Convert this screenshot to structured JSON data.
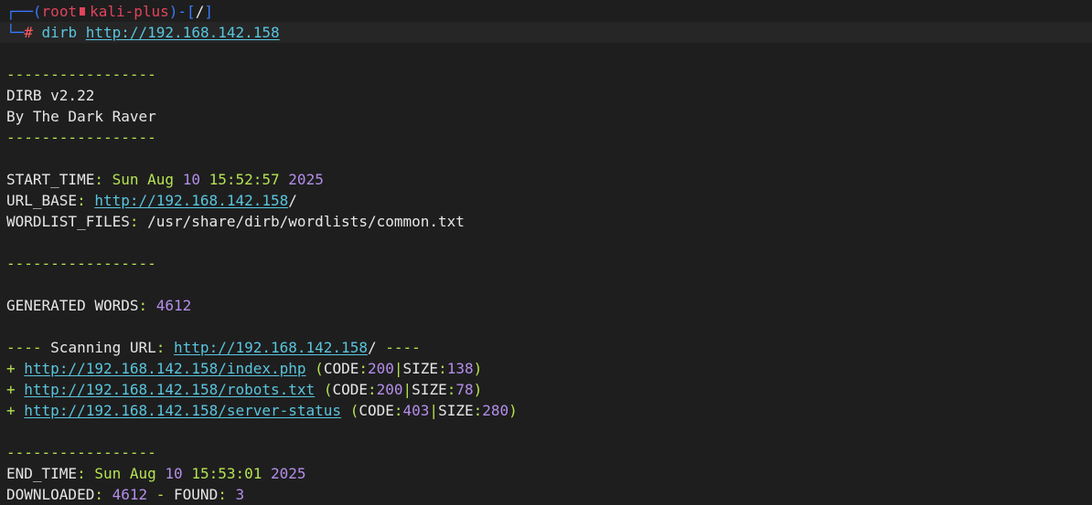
{
  "prompt": {
    "corner_top": "┌──",
    "open": "(",
    "user": "root",
    "host": "kali-plus",
    "close_dash": ")-[",
    "path": "/",
    "close": "]",
    "corner_bottom": "└─",
    "hash": "#",
    "command": "dirb",
    "target": "http://192.168.142.158"
  },
  "output": {
    "separator": "-----------------",
    "version": "DIRB v2.22",
    "author": "By The Dark Raver",
    "start_time_label": "START_TIME",
    "start_day": "Sun",
    "start_month": "Aug",
    "start_date": "10",
    "start_clock": "15:52:57",
    "start_year": "2025",
    "url_base_label": "URL_BASE",
    "url_base": "http://192.168.142.158",
    "url_base_slash": "/",
    "wordlist_label": "WORDLIST_FILES",
    "wordlist": "/usr/share/dirb/wordlists/common.txt",
    "generated_label": "GENERATED WORDS",
    "generated_count": "4612",
    "scan_prefix": "----",
    "scan_label": "Scanning URL",
    "scan_url": "http://192.168.142.158",
    "scan_slash": "/",
    "scan_suffix": "----",
    "results": [
      {
        "url": "http://192.168.142.158/index.php",
        "code": "200",
        "size": "138"
      },
      {
        "url": "http://192.168.142.158/robots.txt",
        "code": "200",
        "size": "78"
      },
      {
        "url": "http://192.168.142.158/server-status",
        "code": "403",
        "size": "280"
      }
    ],
    "code_label": "CODE",
    "size_label": "SIZE",
    "end_time_label": "END_TIME",
    "end_day": "Sun",
    "end_month": "Aug",
    "end_date": "10",
    "end_clock": "15:53:01",
    "end_year": "2025",
    "downloaded_label": "DOWNLOADED",
    "downloaded_count": "4612",
    "found_label": "FOUND",
    "found_count": "3"
  },
  "colors": {
    "background": "#1e1e1e",
    "separator_green": "#b5e352",
    "link_cyan": "#59c5de",
    "number_purple": "#b48eea",
    "prompt_blue": "#3b78ff",
    "prompt_red": "#e0445c"
  }
}
